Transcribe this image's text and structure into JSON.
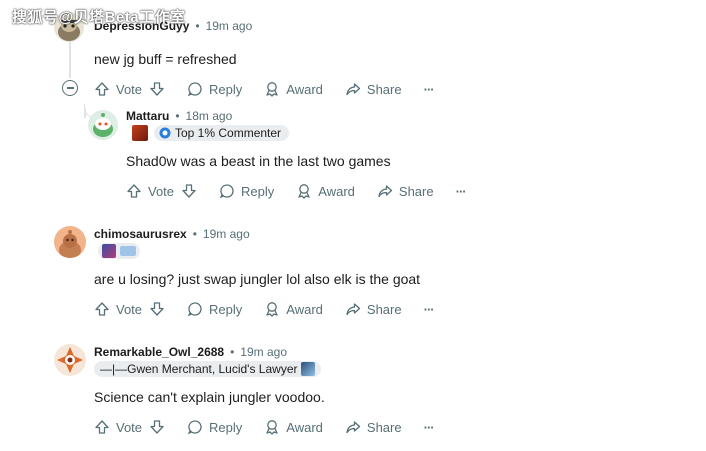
{
  "watermark": "搜狐号@贝塔Beta工作室",
  "actions": {
    "vote": "Vote",
    "reply": "Reply",
    "award": "Award",
    "share": "Share",
    "more": "···"
  },
  "comments": [
    {
      "username": "DepressionGuyy",
      "time": "19m ago",
      "body": "new jg buff = refreshed"
    },
    {
      "username": "Mattaru",
      "time": "18m ago",
      "flair": "Top 1% Commenter",
      "body": "Shad0w was a beast in the last two games"
    },
    {
      "username": "chimosaurusrex",
      "time": "19m ago",
      "body": "are u losing? just swap jungler lol also elk is the goat"
    },
    {
      "username": "Remarkable_Owl_2688",
      "time": "19m ago",
      "flair": "—|—Gwen Merchant, Lucid's Lawyer",
      "body": "Science can't explain jungler voodoo."
    }
  ],
  "colors": {
    "meta": "#576f76",
    "text": "#1c1c1c",
    "flair_bg": "#eaedef",
    "thread_line": "#dfe3e5"
  }
}
